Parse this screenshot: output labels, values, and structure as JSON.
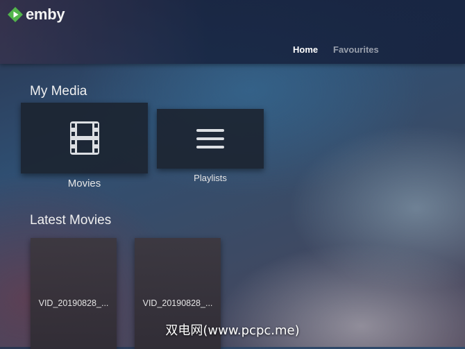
{
  "app": {
    "name": "emby"
  },
  "nav": {
    "items": [
      {
        "label": "Home",
        "active": true
      },
      {
        "label": "Favourites",
        "active": false
      }
    ]
  },
  "my_media": {
    "title": "My Media",
    "libraries": [
      {
        "label": "Movies",
        "icon": "film-icon"
      },
      {
        "label": "Playlists",
        "icon": "list-icon"
      }
    ]
  },
  "latest_movies": {
    "title": "Latest Movies",
    "items": [
      {
        "title": "VID_20190828_..."
      },
      {
        "title": "VID_20190828_..."
      }
    ]
  },
  "watermark": {
    "text": "双电网(www.pcpc.me)"
  },
  "colors": {
    "brand": "#52b54b",
    "header": "#16223e",
    "card": "#1c2430"
  }
}
